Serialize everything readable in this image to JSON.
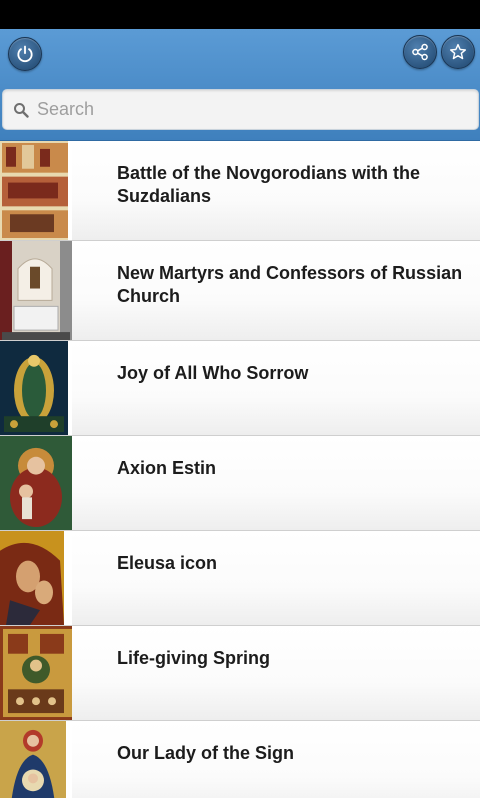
{
  "search": {
    "placeholder": "Search",
    "value": ""
  },
  "header": {
    "power_icon": "power-icon",
    "share_icon": "share-icon",
    "favorite_icon": "star-icon"
  },
  "items": [
    {
      "title": "Battle of the Novgorodians with the Suzdalians",
      "thumb_colors": [
        "#7a2a1c",
        "#c98a4b",
        "#e8d9b0"
      ]
    },
    {
      "title": "New Martyrs and Confessors of Russian Church",
      "thumb_colors": [
        "#6a1f1f",
        "#d9d2c6",
        "#8c8c8c"
      ]
    },
    {
      "title": "Joy of All Who Sorrow",
      "thumb_colors": [
        "#0f2a3f",
        "#c9a23a",
        "#2a5b3a"
      ]
    },
    {
      "title": "Axion Estin",
      "thumb_colors": [
        "#2f5a38",
        "#c78b3a",
        "#8c2a1e"
      ]
    },
    {
      "title": "Eleusa icon",
      "thumb_colors": [
        "#c8921e",
        "#7a2a14",
        "#2c2a3a"
      ]
    },
    {
      "title": "Life-giving Spring",
      "thumb_colors": [
        "#8a3a1a",
        "#c99a3e",
        "#3f5a2a"
      ]
    },
    {
      "title": "Our Lady of the Sign",
      "thumb_colors": [
        "#c9a44a",
        "#1f3a6a",
        "#b23a2a"
      ]
    }
  ]
}
